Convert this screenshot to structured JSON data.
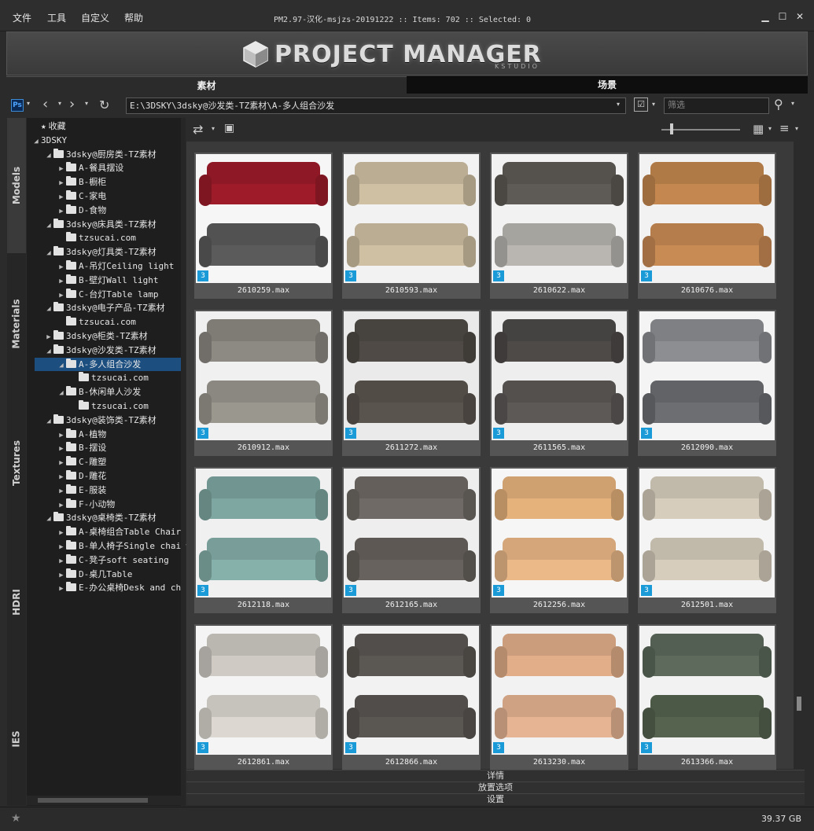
{
  "menubar": {
    "items": [
      "文件",
      "工具",
      "自定义",
      "帮助"
    ],
    "title": "PM2.97-汉化-msjzs-20191222  :: Items: 702  :: Selected: 0"
  },
  "banner": {
    "logo": "PROJECT MANAGER",
    "sub": "KSTUDIO"
  },
  "tabs": [
    "素材",
    "场景"
  ],
  "toolbar": {
    "path": "E:\\3DSKY\\3dsky@沙发类-TZ素材\\A-多人组合沙发",
    "filter_placeholder": "筛选"
  },
  "side_tabs": [
    "Models",
    "Materials",
    "Textures",
    "HDRI",
    "IES"
  ],
  "tree": [
    {
      "label": "收藏",
      "depth": 0,
      "arrow": "",
      "icon": "star"
    },
    {
      "label": "3DSKY",
      "depth": 0,
      "arrow": "◢",
      "icon": "none"
    },
    {
      "label": "3dsky@厨房类-TZ素材",
      "depth": 1,
      "arrow": "◢",
      "icon": "folder"
    },
    {
      "label": "A-餐具摆设",
      "depth": 2,
      "arrow": "▶",
      "icon": "folder"
    },
    {
      "label": "B-橱柜",
      "depth": 2,
      "arrow": "▶",
      "icon": "folder"
    },
    {
      "label": "C-家电",
      "depth": 2,
      "arrow": "▶",
      "icon": "folder"
    },
    {
      "label": "D-食物",
      "depth": 2,
      "arrow": "▶",
      "icon": "folder"
    },
    {
      "label": "3dsky@床具类-TZ素材",
      "depth": 1,
      "arrow": "◢",
      "icon": "folder"
    },
    {
      "label": "tzsucai.com",
      "depth": 2,
      "arrow": "",
      "icon": "folder"
    },
    {
      "label": "3dsky@灯具类-TZ素材",
      "depth": 1,
      "arrow": "◢",
      "icon": "folder"
    },
    {
      "label": "A-吊灯Ceiling light",
      "depth": 2,
      "arrow": "▶",
      "icon": "folder"
    },
    {
      "label": "B-壁灯Wall light",
      "depth": 2,
      "arrow": "▶",
      "icon": "folder"
    },
    {
      "label": "C-台灯Table lamp",
      "depth": 2,
      "arrow": "▶",
      "icon": "folder"
    },
    {
      "label": "3dsky@电子产品-TZ素材",
      "depth": 1,
      "arrow": "◢",
      "icon": "folder"
    },
    {
      "label": "tzsucai.com",
      "depth": 2,
      "arrow": "",
      "icon": "folder"
    },
    {
      "label": "3dsky@柜类-TZ素材",
      "depth": 1,
      "arrow": "▶",
      "icon": "folder"
    },
    {
      "label": "3dsky@沙发类-TZ素材",
      "depth": 1,
      "arrow": "◢",
      "icon": "folder"
    },
    {
      "label": "A-多人组合沙发",
      "depth": 2,
      "arrow": "◢",
      "icon": "folder",
      "selected": true
    },
    {
      "label": "tzsucai.com",
      "depth": 3,
      "arrow": "",
      "icon": "folder"
    },
    {
      "label": "B-休闲单人沙发",
      "depth": 2,
      "arrow": "◢",
      "icon": "folder"
    },
    {
      "label": "tzsucai.com",
      "depth": 3,
      "arrow": "",
      "icon": "folder"
    },
    {
      "label": "3dsky@装饰类-TZ素材",
      "depth": 1,
      "arrow": "◢",
      "icon": "folder"
    },
    {
      "label": "A-植物",
      "depth": 2,
      "arrow": "▶",
      "icon": "folder"
    },
    {
      "label": "B-摆设",
      "depth": 2,
      "arrow": "▶",
      "icon": "folder"
    },
    {
      "label": "C-雕塑",
      "depth": 2,
      "arrow": "▶",
      "icon": "folder"
    },
    {
      "label": "D-雕花",
      "depth": 2,
      "arrow": "▶",
      "icon": "folder"
    },
    {
      "label": "E-服装",
      "depth": 2,
      "arrow": "▶",
      "icon": "folder"
    },
    {
      "label": "F-小动物",
      "depth": 2,
      "arrow": "▶",
      "icon": "folder"
    },
    {
      "label": "3dsky@桌椅类-TZ素材",
      "depth": 1,
      "arrow": "◢",
      "icon": "folder"
    },
    {
      "label": "A-桌椅组合Table Chair",
      "depth": 2,
      "arrow": "▶",
      "icon": "folder"
    },
    {
      "label": "B-单人椅子Single chair",
      "depth": 2,
      "arrow": "▶",
      "icon": "folder"
    },
    {
      "label": "C-凳子soft seating",
      "depth": 2,
      "arrow": "▶",
      "icon": "folder"
    },
    {
      "label": "D-桌几Table",
      "depth": 2,
      "arrow": "▶",
      "icon": "folder"
    },
    {
      "label": "E-办公桌椅Desk and chair",
      "depth": 2,
      "arrow": "▶",
      "icon": "folder"
    }
  ],
  "items": [
    {
      "name": "2610259.max",
      "color": "#9e1b2a",
      "color2": "#5b5b5b",
      "bg": "#f6f6f6"
    },
    {
      "name": "2610593.max",
      "color": "#cfc0a3",
      "color2": "#cfc0a3",
      "bg": "#f2f2f2"
    },
    {
      "name": "2610622.max",
      "color": "#5e5a55",
      "color2": "#b9b6b1",
      "bg": "#f2f2f2"
    },
    {
      "name": "2610676.max",
      "color": "#c4874f",
      "color2": "#c98b54",
      "bg": "#f2f2f2"
    },
    {
      "name": "2610912.max",
      "color": "#8d8a83",
      "color2": "#9a978f",
      "bg": "#f0f0f0"
    },
    {
      "name": "2611272.max",
      "color": "#4f4a45",
      "color2": "#5a544e",
      "bg": "#eaeaea"
    },
    {
      "name": "2611565.max",
      "color": "#4d4a48",
      "color2": "#5c5957",
      "bg": "#eeeeee"
    },
    {
      "name": "2612090.max",
      "color": "#8c8e92",
      "color2": "#6c6e72",
      "bg": "#f4f4f4"
    },
    {
      "name": "2612118.max",
      "color": "#7ea7a1",
      "color2": "#86b0aa",
      "bg": "#f0f0f0"
    },
    {
      "name": "2612165.max",
      "color": "#6f6a65",
      "color2": "#67625d",
      "bg": "#eeeeee"
    },
    {
      "name": "2612256.max",
      "color": "#e6b27c",
      "color2": "#ebb988",
      "bg": "#f6f6f6"
    },
    {
      "name": "2612501.max",
      "color": "#d6cdbc",
      "color2": "#d6cdbc",
      "bg": "#f4f4f4"
    },
    {
      "name": "2612861.max",
      "color": "#cfcbc4",
      "color2": "#dcd8d1",
      "bg": "#f4f4f4"
    },
    {
      "name": "2612866.max",
      "color": "#5b5753",
      "color2": "#5a5652",
      "bg": "#f2f2f2"
    },
    {
      "name": "2613230.max",
      "color": "#e2ae8a",
      "color2": "#e6b493",
      "bg": "#f2f2f2"
    },
    {
      "name": "2613366.max",
      "color": "#5d6a5c",
      "color2": "#56634f",
      "bg": "#f2f2f2"
    }
  ],
  "bottom_panels": [
    "详情",
    "放置选项",
    "设置"
  ],
  "status": {
    "disk": "39.37 GB"
  },
  "colors": {
    "tab_active": "#2b2b2b",
    "tab_inactive": "#111111",
    "selection": "#1c4f80",
    "max_badge": "#1a9ad6"
  }
}
